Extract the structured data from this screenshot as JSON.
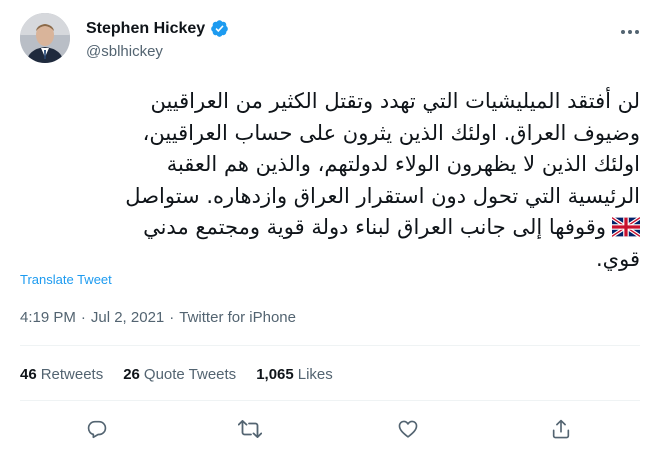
{
  "author": {
    "display_name": "Stephen Hickey",
    "handle": "@sblhickey"
  },
  "tweet": {
    "text_lines": [
      "لن أفتقد الميليشيات التي تهدد وتقتل الكثير من العراقيين",
      "وضيوف العراق. اولئك الذين يثرون على حساب العراقيين،",
      "اولئك الذين لا يظهرون الولاء لدولتهم، والذين هم العقبة",
      "الرئيسية التي تحول دون استقرار العراق وازدهاره. ستواصل",
      "وقوفها إلى جانب العراق لبناء دولة قوية ومجتمع مدني",
      "قوي."
    ],
    "translate_label": "Translate Tweet",
    "time": "4:19 PM",
    "date": "Jul 2, 2021",
    "source": "Twitter for iPhone",
    "separator": "·"
  },
  "stats": {
    "retweets": {
      "count": "46",
      "label": "Retweets"
    },
    "quotes": {
      "count": "26",
      "label": "Quote Tweets"
    },
    "likes": {
      "count": "1,065",
      "label": "Likes"
    }
  },
  "icons": {
    "verified": "verified-badge-icon",
    "more": "more-options-icon",
    "flag": "uk-flag-emoji",
    "reply": "reply-icon",
    "retweet": "retweet-icon",
    "like": "like-icon",
    "share": "share-icon"
  },
  "colors": {
    "accent": "#1d9bf0",
    "secondary_text": "#536471",
    "divider": "#eff3f4"
  }
}
